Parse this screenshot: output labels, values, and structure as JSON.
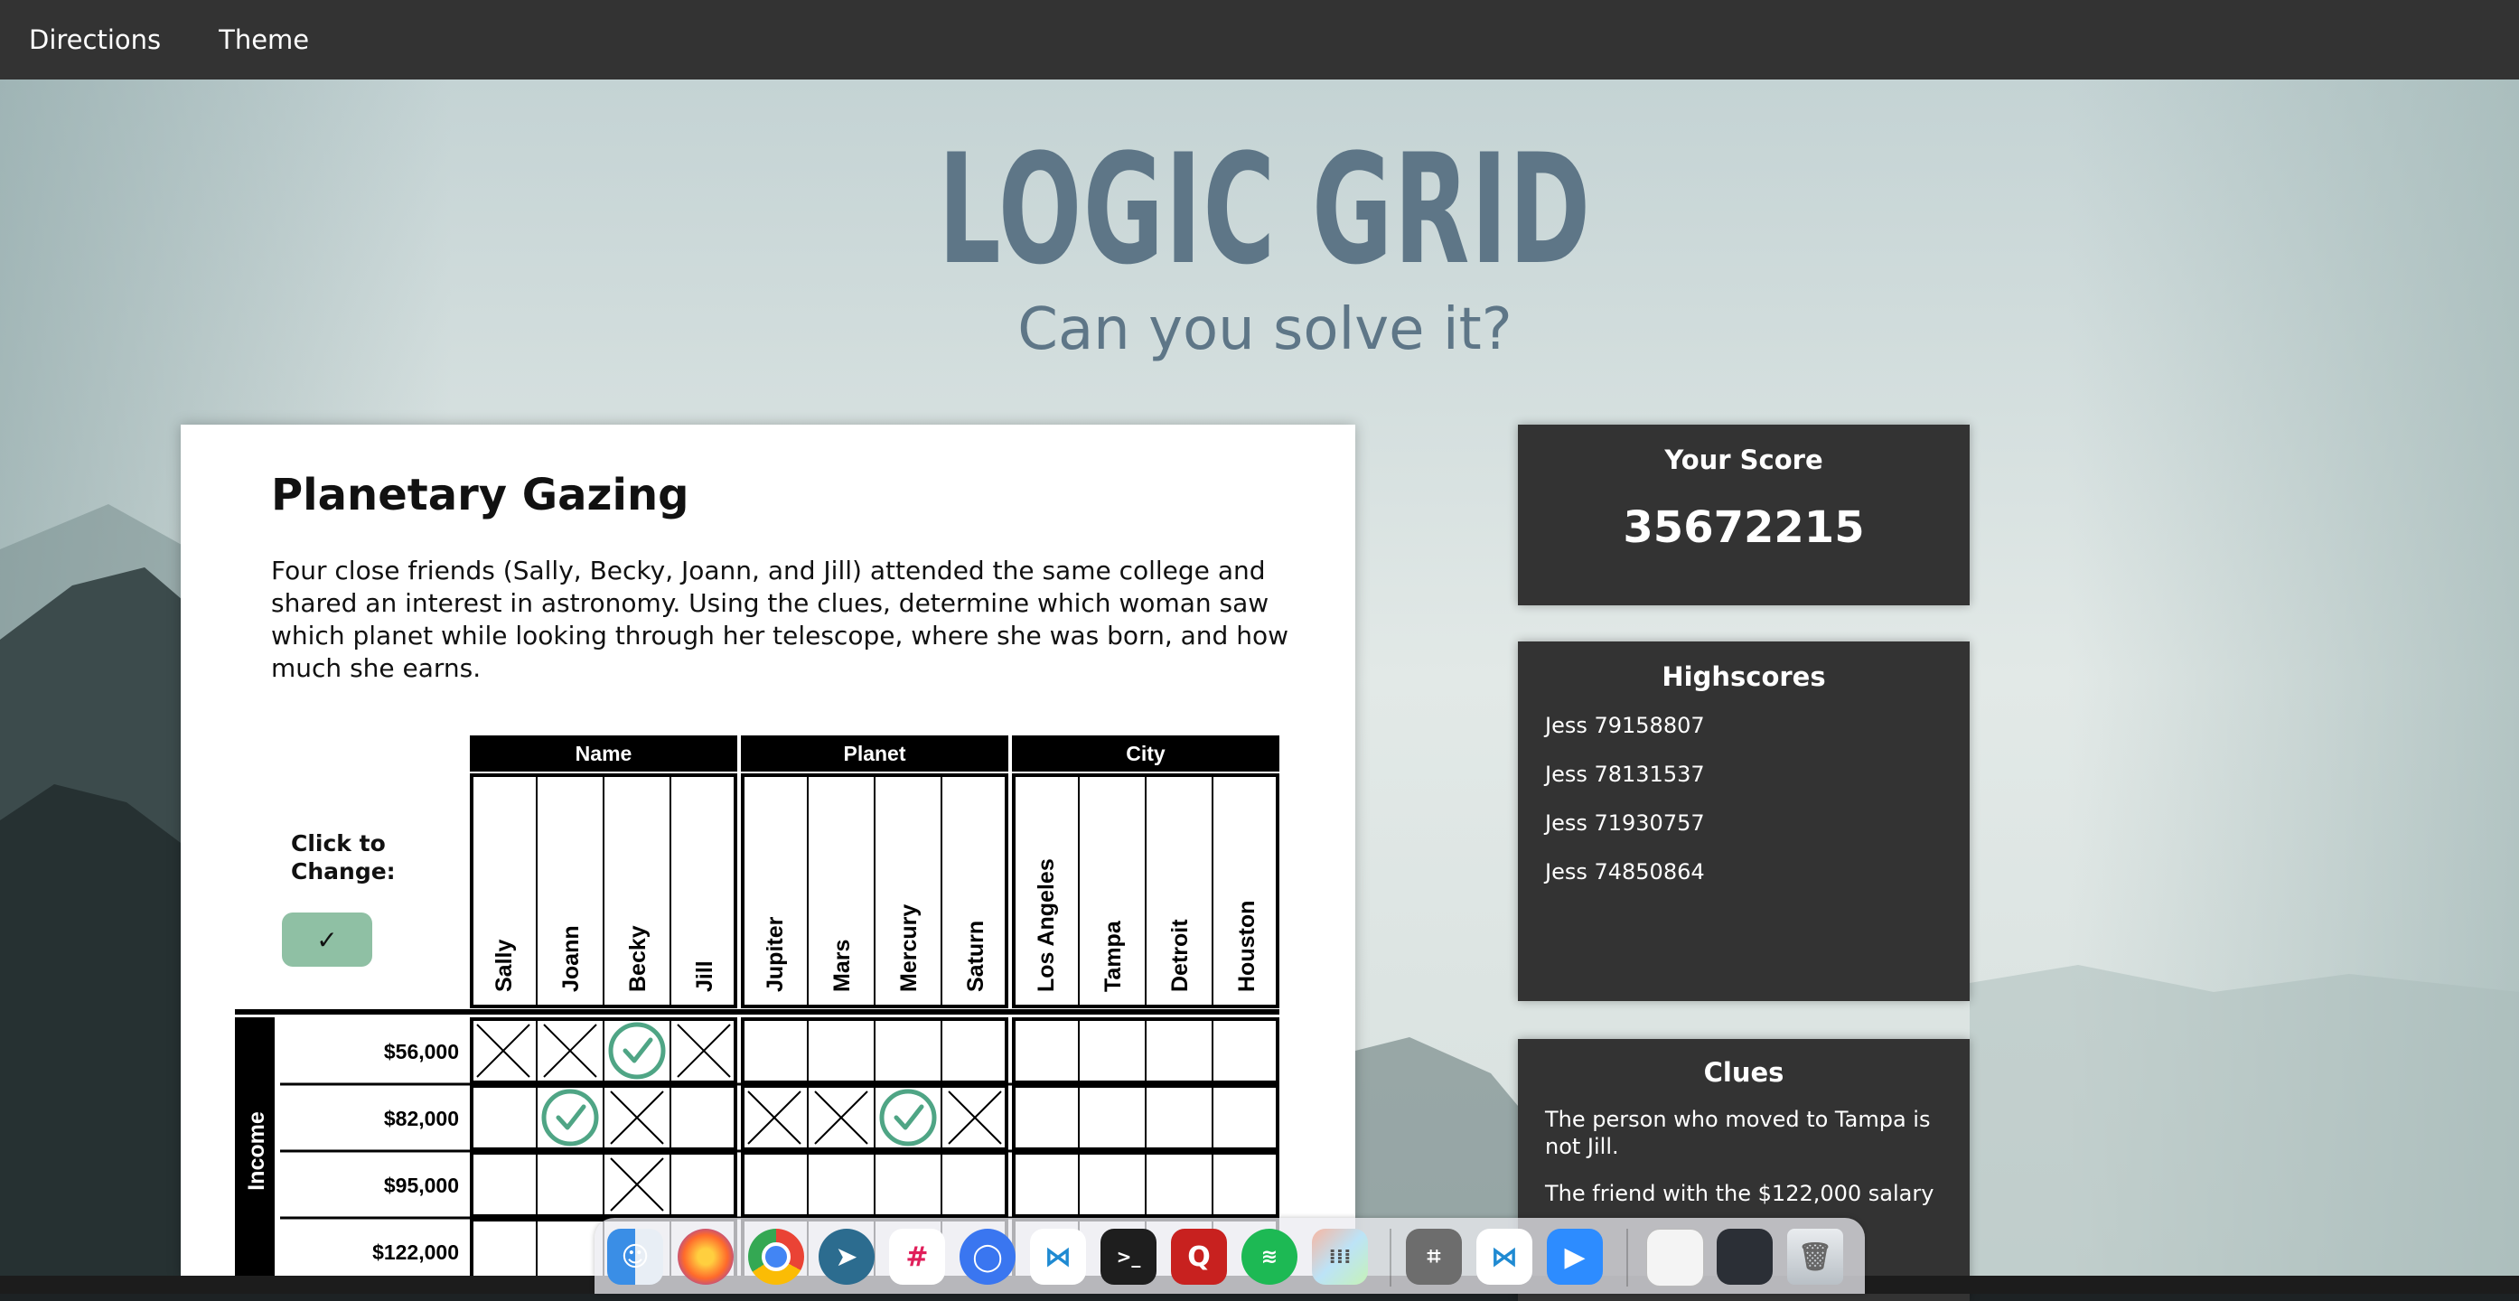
{
  "nav": {
    "directions": "Directions",
    "theme": "Theme"
  },
  "header": {
    "title": "LOGIC GRID",
    "subtitle": "Can you solve it?"
  },
  "puzzle": {
    "title": "Planetary Gazing",
    "description": "Four close friends (Sally, Becky, Joann, and Jill) attended the same college and shared an interest in astronomy. Using the clues, determine which woman saw which planet while looking through her telescope, where she was born, and how much she earns.",
    "click_to_change": "Click to Change:",
    "mark_symbol": "✓",
    "groups": [
      {
        "label": "Name",
        "items": [
          "Sally",
          "Joann",
          "Becky",
          "Jill"
        ]
      },
      {
        "label": "Planet",
        "items": [
          "Jupiter",
          "Mars",
          "Mercury",
          "Saturn"
        ]
      },
      {
        "label": "City",
        "items": [
          "Los Angeles",
          "Tampa",
          "Detroit",
          "Houston"
        ]
      }
    ],
    "row_group": {
      "label": "Income",
      "items": [
        "$56,000",
        "$82,000",
        "$95,000",
        "$122,000"
      ]
    },
    "cells": [
      [
        "x",
        "x",
        "check",
        "x",
        "",
        "",
        "",
        "",
        "",
        "",
        "",
        ""
      ],
      [
        "",
        "check",
        "x",
        "",
        "x",
        "x",
        "check",
        "x",
        "",
        "",
        "",
        ""
      ],
      [
        "",
        "",
        "x",
        "",
        "",
        "",
        "",
        "",
        "",
        "",
        "",
        ""
      ],
      [
        "",
        "",
        "",
        "",
        "",
        "",
        "",
        "",
        "",
        "",
        "",
        ""
      ]
    ],
    "colors": {
      "check": "#4fa585",
      "header": "#000000"
    }
  },
  "score": {
    "label": "Your Score",
    "value": "35672215"
  },
  "highscores": {
    "label": "Highscores",
    "items": [
      "Jess 79158807",
      "Jess 78131537",
      "Jess 71930757",
      "Jess 74850864"
    ]
  },
  "clues": {
    "label": "Clues",
    "items": [
      "The person who moved to Tampa is not Jill.",
      "The friend with the $122,000 salary"
    ]
  },
  "dock": {
    "icons": [
      "finder-icon",
      "firefox-icon",
      "chrome-icon",
      "telegram-icon",
      "slack-icon",
      "signal-icon",
      "vscode-icon",
      "terminal-icon",
      "quora-icon",
      "spotify-icon",
      "launchpad-icon",
      "calculator-icon",
      "vscode-icon",
      "zoom-icon",
      "window-thumbnail-icon",
      "window-thumbnail-icon",
      "trash-icon"
    ]
  }
}
